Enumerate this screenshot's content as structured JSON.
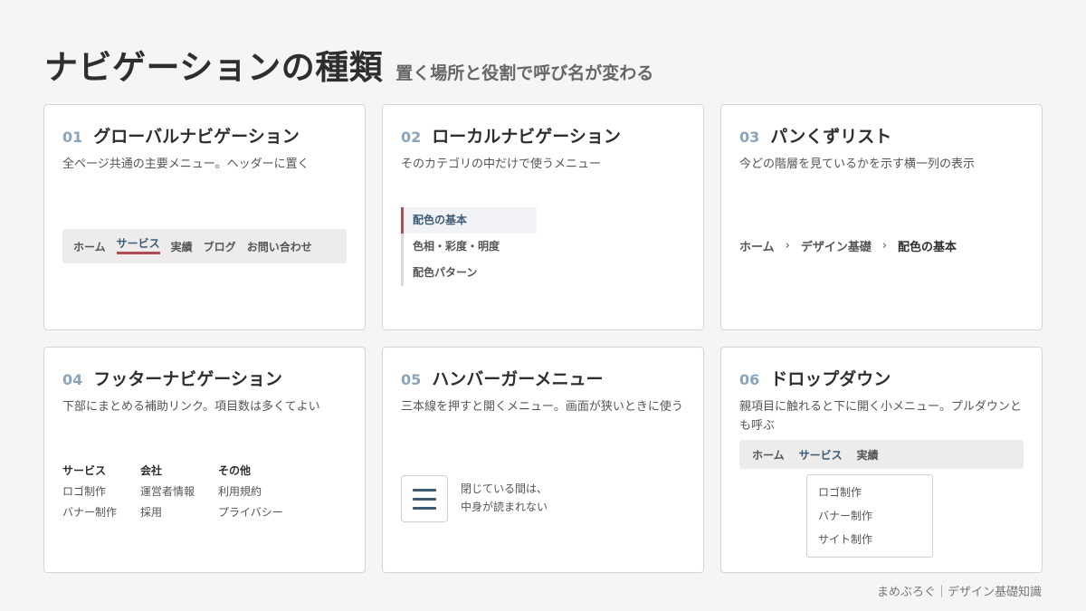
{
  "header": {
    "title": "ナビゲーションの種類",
    "subtitle": "置く場所と役割で呼び名が変わる"
  },
  "cards": [
    {
      "num": "01",
      "title": "グローバルナビゲーション",
      "desc": "全ページ共通の主要メニュー。ヘッダーに置く",
      "demo": {
        "items": [
          "ホーム",
          "サービス",
          "実績",
          "ブログ",
          "お問い合わせ"
        ],
        "active_index": 1
      }
    },
    {
      "num": "02",
      "title": "ローカルナビゲーション",
      "desc": "そのカテゴリの中だけで使うメニュー",
      "demo": {
        "items": [
          "配色の基本",
          "色相・彩度・明度",
          "配色パターン"
        ],
        "active_index": 0
      }
    },
    {
      "num": "03",
      "title": "パンくずリスト",
      "desc": "今どの階層を見ているかを示す横一列の表示",
      "demo": {
        "items": [
          "ホーム",
          "デザイン基礎",
          "配色の基本"
        ],
        "separator": "›"
      }
    },
    {
      "num": "04",
      "title": "フッターナビゲーション",
      "desc": "下部にまとめる補助リンク。項目数は多くてよい",
      "demo": {
        "columns": [
          {
            "head": "サービス",
            "links": [
              "ロゴ制作",
              "バナー制作"
            ]
          },
          {
            "head": "会社",
            "links": [
              "運営者情報",
              "採用"
            ]
          },
          {
            "head": "その他",
            "links": [
              "利用規約",
              "プライバシー"
            ]
          }
        ]
      }
    },
    {
      "num": "05",
      "title": "ハンバーガーメニュー",
      "desc": "三本線を押すと開くメニュー。画面が狭いときに使う",
      "demo": {
        "icon": "hamburger-icon",
        "note_line1": "閉じている間は、",
        "note_line2": "中身が読まれない"
      }
    },
    {
      "num": "06",
      "title": "ドロップダウン",
      "desc": "親項目に触れると下に開く小メニュー。プルダウンとも呼ぶ",
      "demo": {
        "bar": [
          "ホーム",
          "サービス",
          "実績"
        ],
        "active_index": 1,
        "menu": [
          "ロゴ制作",
          "バナー制作",
          "サイト制作"
        ]
      }
    }
  ],
  "footer": {
    "credit": "まめぶろぐ｜デザイン基礎知識"
  },
  "colors": {
    "accent": "#b24a56",
    "navy": "#3d5a75",
    "number": "#8aa5bb",
    "background": "#f5f5f3"
  }
}
